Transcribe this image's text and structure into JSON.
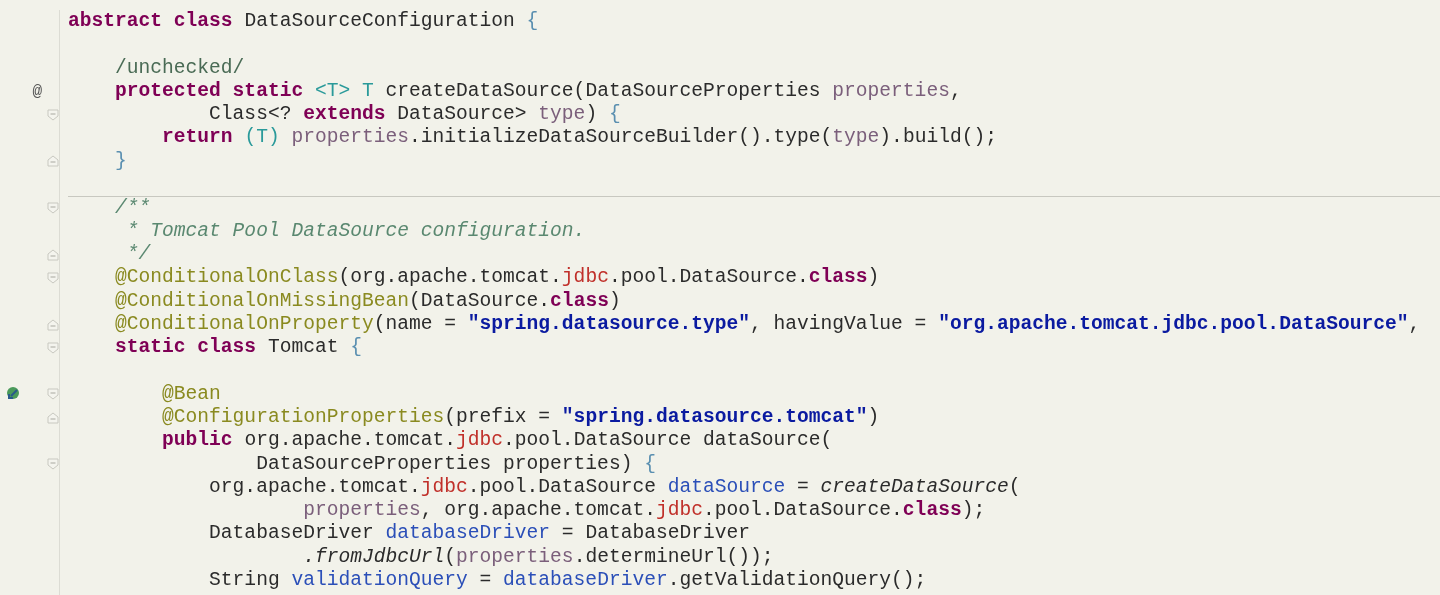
{
  "editor": {
    "lines": [
      {
        "tokens": [
          {
            "kind": "kw",
            "text": "abstract class"
          },
          {
            "kind": "plain",
            "text": " DataSourceConfiguration "
          },
          {
            "kind": "brace",
            "text": "{"
          }
        ]
      },
      {
        "blank": true
      },
      {
        "tokens": [
          {
            "kind": "cmt",
            "text": "    /unchecked/"
          }
        ]
      },
      {
        "marker": "@",
        "tokens": [
          {
            "kind": "kw",
            "text": "    protected static"
          },
          {
            "kind": "tparam",
            "text": " <T> T"
          },
          {
            "kind": "plain",
            "text": " createDataSource(DataSourceProperties "
          },
          {
            "kind": "param",
            "text": "properties"
          },
          {
            "kind": "plain",
            "text": ","
          }
        ]
      },
      {
        "fold_start": true,
        "tokens": [
          {
            "kind": "plain",
            "text": "            Class<? "
          },
          {
            "kind": "kw",
            "text": "extends"
          },
          {
            "kind": "plain",
            "text": " DataSource> "
          },
          {
            "kind": "param",
            "text": "type"
          },
          {
            "kind": "plain",
            "text": ") "
          },
          {
            "kind": "brace",
            "text": "{"
          }
        ]
      },
      {
        "tokens": [
          {
            "kind": "kw",
            "text": "        return"
          },
          {
            "kind": "tparam",
            "text": " (T)"
          },
          {
            "kind": "param",
            "text": " properties"
          },
          {
            "kind": "plain",
            "text": ".initializeDataSourceBuilder().type("
          },
          {
            "kind": "param",
            "text": "type"
          },
          {
            "kind": "plain",
            "text": ").build();"
          }
        ]
      },
      {
        "fold_end": true,
        "tokens": [
          {
            "kind": "brace",
            "text": "    }"
          }
        ]
      },
      {
        "blank": true
      },
      {
        "fold_start": true,
        "separator": true,
        "tokens": [
          {
            "kind": "doc",
            "text": "    /**"
          }
        ]
      },
      {
        "tokens": [
          {
            "kind": "doc",
            "text": "     * Tomcat Pool DataSource configuration."
          }
        ]
      },
      {
        "fold_end": true,
        "tokens": [
          {
            "kind": "doc",
            "text": "     */"
          }
        ]
      },
      {
        "fold_start": true,
        "tokens": [
          {
            "kind": "ann",
            "text": "    @ConditionalOnClass"
          },
          {
            "kind": "plain",
            "text": "(org.apache.tomcat."
          },
          {
            "kind": "pkg",
            "text": "jdbc"
          },
          {
            "kind": "plain",
            "text": ".pool.DataSource."
          },
          {
            "kind": "kw",
            "text": "class"
          },
          {
            "kind": "plain",
            "text": ")"
          }
        ]
      },
      {
        "tokens": [
          {
            "kind": "ann",
            "text": "    @ConditionalOnMissingBean"
          },
          {
            "kind": "plain",
            "text": "(DataSource."
          },
          {
            "kind": "kw",
            "text": "class"
          },
          {
            "kind": "plain",
            "text": ")"
          }
        ]
      },
      {
        "fold_end": true,
        "tokens": [
          {
            "kind": "ann",
            "text": "    @ConditionalOnProperty"
          },
          {
            "kind": "plain",
            "text": "(name = "
          },
          {
            "kind": "str",
            "text": "\"spring.datasource.type\""
          },
          {
            "kind": "plain",
            "text": ", havingValue = "
          },
          {
            "kind": "str",
            "text": "\"org.apache.tomcat.jdbc.pool.DataSource\""
          },
          {
            "kind": "plain",
            "text": ","
          }
        ]
      },
      {
        "fold_start": true,
        "tokens": [
          {
            "kind": "kw",
            "text": "    static class"
          },
          {
            "kind": "plain",
            "text": " Tomcat "
          },
          {
            "kind": "brace",
            "text": "{"
          }
        ]
      },
      {
        "blank": true
      },
      {
        "gutter_icon": true,
        "fold_start": true,
        "tokens": [
          {
            "kind": "ann",
            "text": "        @Bean"
          }
        ]
      },
      {
        "fold_end": true,
        "tokens": [
          {
            "kind": "ann",
            "text": "        @ConfigurationProperties"
          },
          {
            "kind": "plain",
            "text": "(prefix = "
          },
          {
            "kind": "str",
            "text": "\"spring.datasource.tomcat\""
          },
          {
            "kind": "plain",
            "text": ")"
          }
        ]
      },
      {
        "tokens": [
          {
            "kind": "kw",
            "text": "        public"
          },
          {
            "kind": "plain",
            "text": " org.apache.tomcat."
          },
          {
            "kind": "pkg",
            "text": "jdbc"
          },
          {
            "kind": "plain",
            "text": ".pool.DataSource dataSource("
          }
        ]
      },
      {
        "fold_start": true,
        "tokens": [
          {
            "kind": "plain",
            "text": "                DataSourceProperties properties) "
          },
          {
            "kind": "brace",
            "text": "{"
          }
        ]
      },
      {
        "tokens": [
          {
            "kind": "plain",
            "text": "            org.apache.tomcat."
          },
          {
            "kind": "pkg",
            "text": "jdbc"
          },
          {
            "kind": "plain",
            "text": ".pool.DataSource "
          },
          {
            "kind": "local",
            "text": "dataSource"
          },
          {
            "kind": "plain",
            "text": " = "
          },
          {
            "kind": "call",
            "text": "createDataSource"
          },
          {
            "kind": "plain",
            "text": "("
          }
        ]
      },
      {
        "tokens": [
          {
            "kind": "param",
            "text": "                    properties"
          },
          {
            "kind": "plain",
            "text": ", org.apache.tomcat."
          },
          {
            "kind": "pkg",
            "text": "jdbc"
          },
          {
            "kind": "plain",
            "text": ".pool.DataSource."
          },
          {
            "kind": "kw",
            "text": "class"
          },
          {
            "kind": "plain",
            "text": ");"
          }
        ]
      },
      {
        "tokens": [
          {
            "kind": "plain",
            "text": "            DatabaseDriver "
          },
          {
            "kind": "local",
            "text": "databaseDriver"
          },
          {
            "kind": "plain",
            "text": " = DatabaseDriver"
          }
        ]
      },
      {
        "tokens": [
          {
            "kind": "call",
            "text": "                    .fromJdbcUrl"
          },
          {
            "kind": "plain",
            "text": "("
          },
          {
            "kind": "param",
            "text": "properties"
          },
          {
            "kind": "plain",
            "text": ".determineUrl());"
          }
        ]
      },
      {
        "tokens": [
          {
            "kind": "plain",
            "text": "            String "
          },
          {
            "kind": "local",
            "text": "validationQuery"
          },
          {
            "kind": "plain",
            "text": " = "
          },
          {
            "kind": "local",
            "text": "databaseDriver"
          },
          {
            "kind": "plain",
            "text": ".getValidationQuery();"
          }
        ]
      }
    ]
  }
}
